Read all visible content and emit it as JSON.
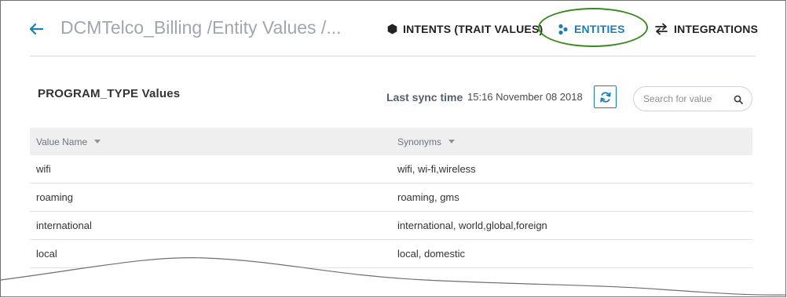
{
  "header": {
    "back_icon": "arrow-left-icon",
    "breadcrumb": "DCMTelco_Billing /Entity Values /...",
    "nav": {
      "intents": {
        "label": "INTENTS (TRAIT VALUES)",
        "icon": "hexagon-icon"
      },
      "entities": {
        "label": "ENTITIES",
        "icon": "entities-dots-icon",
        "active": true
      },
      "integrations": {
        "label": "INTEGRATIONS",
        "icon": "swap-arrows-icon"
      }
    }
  },
  "section": {
    "title": "PROGRAM_TYPE Values",
    "sync_label": "Last sync time",
    "sync_value": "15:16 November 08 2018",
    "sync_icon": "refresh-icon"
  },
  "search": {
    "placeholder": "Search for value",
    "icon": "search-icon"
  },
  "table": {
    "columns": [
      "Value Name",
      "Synonyms"
    ],
    "rows": [
      {
        "name": "wifi",
        "synonyms": "wifi, wi-fi,wireless"
      },
      {
        "name": "roaming",
        "synonyms": "roaming, gms"
      },
      {
        "name": "international",
        "synonyms": "international, world,global,foreign"
      },
      {
        "name": "local",
        "synonyms": "local, domestic"
      }
    ]
  },
  "colors": {
    "accent": "#1a7fb5",
    "highlight": "#3a8a1f",
    "header_bg": "#efefef"
  }
}
